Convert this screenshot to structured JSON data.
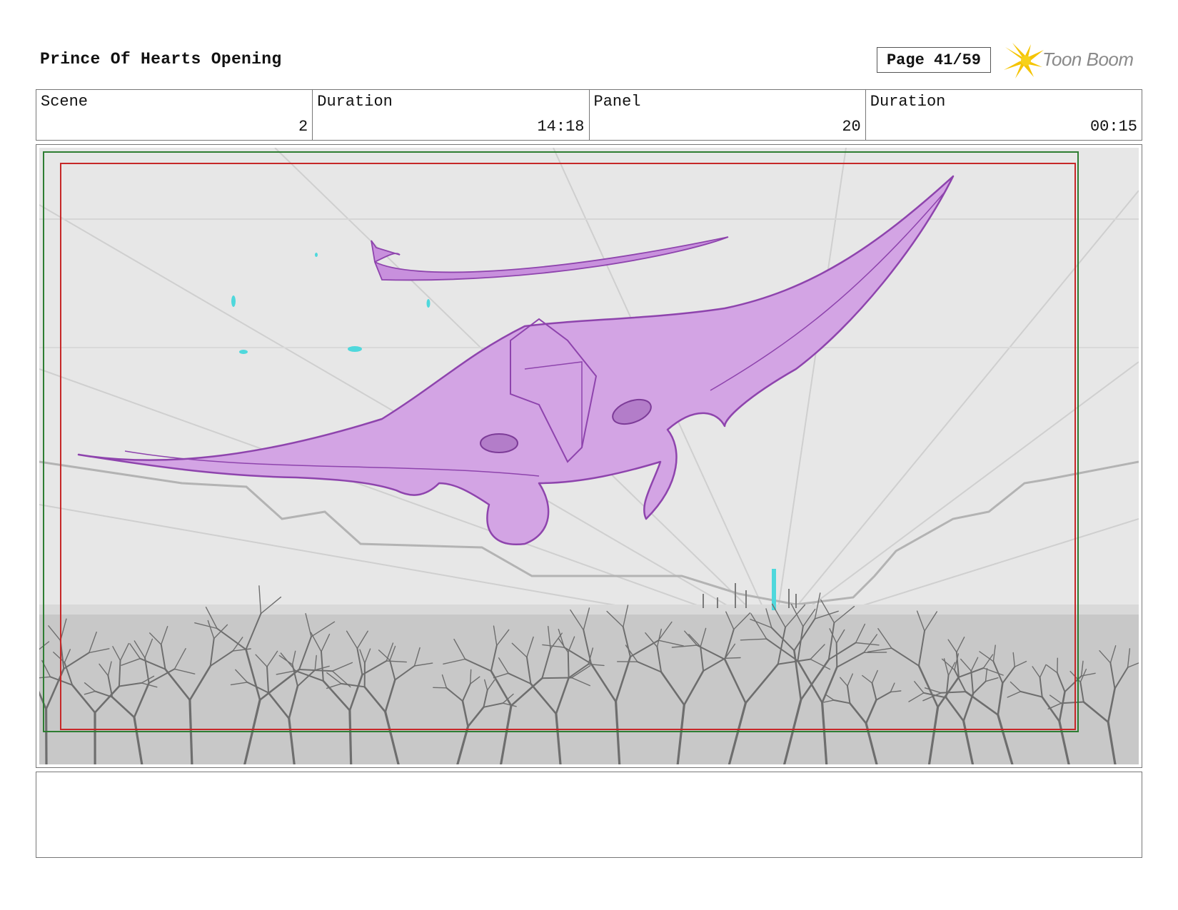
{
  "header": {
    "title": "Prince Of Hearts Opening",
    "page": "Page 41/59",
    "logo_text": "Toon Boom"
  },
  "info": [
    {
      "label": "Scene",
      "value": "2"
    },
    {
      "label": "Duration",
      "value": "14:18"
    },
    {
      "label": "Panel",
      "value": "20"
    },
    {
      "label": "Duration",
      "value": "00:15"
    }
  ],
  "colors": {
    "safe_frame": "#2e7d32",
    "action_frame": "#c62828",
    "creature_fill": "#d3a4e4",
    "creature_line": "#8e44ad",
    "accent_cyan": "#4fd8dc",
    "sky": "#e6e6e6",
    "ground": "#c9c9c9"
  },
  "notes": ""
}
